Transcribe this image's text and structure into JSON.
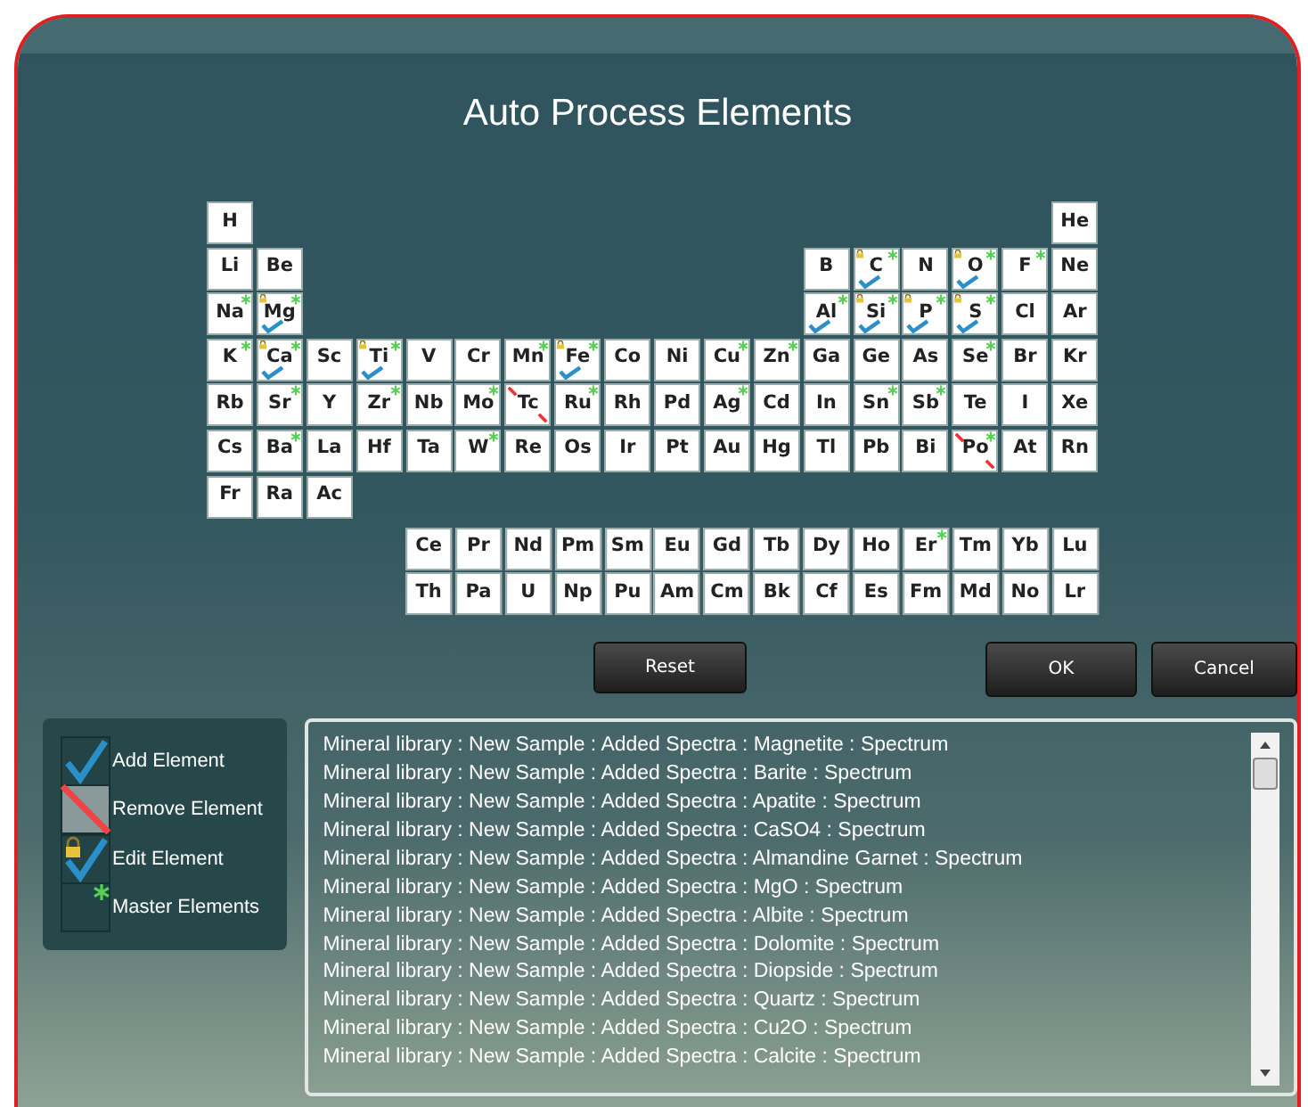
{
  "dialog": {
    "title": "Auto Process Elements"
  },
  "table": {
    "rows": [
      {
        "left": [
          {
            "symbol": "H",
            "added": false,
            "removed": false,
            "locked": false,
            "master": false
          }
        ],
        "right": [
          {
            "symbol": "He",
            "added": false,
            "removed": false,
            "locked": false,
            "master": false
          }
        ]
      },
      {
        "left": [
          {
            "symbol": "Li",
            "added": false,
            "removed": false,
            "locked": false,
            "master": false
          },
          {
            "symbol": "Be",
            "added": false,
            "removed": false,
            "locked": false,
            "master": false
          }
        ],
        "right": [
          {
            "symbol": "B",
            "added": false,
            "removed": false,
            "locked": false,
            "master": false
          },
          {
            "symbol": "C",
            "added": true,
            "removed": false,
            "locked": true,
            "master": true
          },
          {
            "symbol": "N",
            "added": false,
            "removed": false,
            "locked": false,
            "master": false
          },
          {
            "symbol": "O",
            "added": true,
            "removed": false,
            "locked": true,
            "master": true
          },
          {
            "symbol": "F",
            "added": false,
            "removed": false,
            "locked": false,
            "master": true
          },
          {
            "symbol": "Ne",
            "added": false,
            "removed": false,
            "locked": false,
            "master": false
          }
        ]
      },
      {
        "left": [
          {
            "symbol": "Na",
            "added": false,
            "removed": false,
            "locked": false,
            "master": true
          },
          {
            "symbol": "Mg",
            "added": true,
            "removed": false,
            "locked": true,
            "master": true
          }
        ],
        "right": [
          {
            "symbol": "Al",
            "added": true,
            "removed": false,
            "locked": false,
            "master": true
          },
          {
            "symbol": "Si",
            "added": true,
            "removed": false,
            "locked": true,
            "master": true
          },
          {
            "symbol": "P",
            "added": true,
            "removed": false,
            "locked": true,
            "master": true
          },
          {
            "symbol": "S",
            "added": true,
            "removed": false,
            "locked": true,
            "master": true
          },
          {
            "symbol": "Cl",
            "added": false,
            "removed": false,
            "locked": false,
            "master": false
          },
          {
            "symbol": "Ar",
            "added": false,
            "removed": false,
            "locked": false,
            "master": false
          }
        ]
      },
      {
        "left": [
          {
            "symbol": "K",
            "added": false,
            "removed": false,
            "locked": false,
            "master": true
          },
          {
            "symbol": "Ca",
            "added": true,
            "removed": false,
            "locked": true,
            "master": true
          },
          {
            "symbol": "Sc",
            "added": false,
            "removed": false,
            "locked": false,
            "master": false
          },
          {
            "symbol": "Ti",
            "added": true,
            "removed": false,
            "locked": true,
            "master": true
          },
          {
            "symbol": "V",
            "added": false,
            "removed": false,
            "locked": false,
            "master": false
          },
          {
            "symbol": "Cr",
            "added": false,
            "removed": false,
            "locked": false,
            "master": false
          },
          {
            "symbol": "Mn",
            "added": false,
            "removed": false,
            "locked": false,
            "master": true
          },
          {
            "symbol": "Fe",
            "added": true,
            "removed": false,
            "locked": true,
            "master": true
          },
          {
            "symbol": "Co",
            "added": false,
            "removed": false,
            "locked": false,
            "master": false
          },
          {
            "symbol": "Ni",
            "added": false,
            "removed": false,
            "locked": false,
            "master": false
          },
          {
            "symbol": "Cu",
            "added": false,
            "removed": false,
            "locked": false,
            "master": true
          },
          {
            "symbol": "Zn",
            "added": false,
            "removed": false,
            "locked": false,
            "master": true
          },
          {
            "symbol": "Ga",
            "added": false,
            "removed": false,
            "locked": false,
            "master": false
          },
          {
            "symbol": "Ge",
            "added": false,
            "removed": false,
            "locked": false,
            "master": false
          },
          {
            "symbol": "As",
            "added": false,
            "removed": false,
            "locked": false,
            "master": false
          },
          {
            "symbol": "Se",
            "added": false,
            "removed": false,
            "locked": false,
            "master": true
          },
          {
            "symbol": "Br",
            "added": false,
            "removed": false,
            "locked": false,
            "master": false
          },
          {
            "symbol": "Kr",
            "added": false,
            "removed": false,
            "locked": false,
            "master": false
          }
        ]
      },
      {
        "left": [
          {
            "symbol": "Rb",
            "added": false,
            "removed": false,
            "locked": false,
            "master": false
          },
          {
            "symbol": "Sr",
            "added": false,
            "removed": false,
            "locked": false,
            "master": true
          },
          {
            "symbol": "Y",
            "added": false,
            "removed": false,
            "locked": false,
            "master": false
          },
          {
            "symbol": "Zr",
            "added": false,
            "removed": false,
            "locked": false,
            "master": true
          },
          {
            "symbol": "Nb",
            "added": false,
            "removed": false,
            "locked": false,
            "master": false
          },
          {
            "symbol": "Mo",
            "added": false,
            "removed": false,
            "locked": false,
            "master": true
          },
          {
            "symbol": "Tc",
            "added": false,
            "removed": true,
            "locked": false,
            "master": false
          },
          {
            "symbol": "Ru",
            "added": false,
            "removed": false,
            "locked": false,
            "master": true
          },
          {
            "symbol": "Rh",
            "added": false,
            "removed": false,
            "locked": false,
            "master": false
          },
          {
            "symbol": "Pd",
            "added": false,
            "removed": false,
            "locked": false,
            "master": false
          },
          {
            "symbol": "Ag",
            "added": false,
            "removed": false,
            "locked": false,
            "master": true
          },
          {
            "symbol": "Cd",
            "added": false,
            "removed": false,
            "locked": false,
            "master": false
          },
          {
            "symbol": "In",
            "added": false,
            "removed": false,
            "locked": false,
            "master": false
          },
          {
            "symbol": "Sn",
            "added": false,
            "removed": false,
            "locked": false,
            "master": true
          },
          {
            "symbol": "Sb",
            "added": false,
            "removed": false,
            "locked": false,
            "master": true
          },
          {
            "symbol": "Te",
            "added": false,
            "removed": false,
            "locked": false,
            "master": false
          },
          {
            "symbol": "I",
            "added": false,
            "removed": false,
            "locked": false,
            "master": false
          },
          {
            "symbol": "Xe",
            "added": false,
            "removed": false,
            "locked": false,
            "master": false
          }
        ]
      },
      {
        "left": [
          {
            "symbol": "Cs",
            "added": false,
            "removed": false,
            "locked": false,
            "master": false
          },
          {
            "symbol": "Ba",
            "added": false,
            "removed": false,
            "locked": false,
            "master": true
          },
          {
            "symbol": "La",
            "added": false,
            "removed": false,
            "locked": false,
            "master": false
          },
          {
            "symbol": "Hf",
            "added": false,
            "removed": false,
            "locked": false,
            "master": false
          },
          {
            "symbol": "Ta",
            "added": false,
            "removed": false,
            "locked": false,
            "master": false
          },
          {
            "symbol": "W",
            "added": false,
            "removed": false,
            "locked": false,
            "master": true
          },
          {
            "symbol": "Re",
            "added": false,
            "removed": false,
            "locked": false,
            "master": false
          },
          {
            "symbol": "Os",
            "added": false,
            "removed": false,
            "locked": false,
            "master": false
          },
          {
            "symbol": "Ir",
            "added": false,
            "removed": false,
            "locked": false,
            "master": false
          },
          {
            "symbol": "Pt",
            "added": false,
            "removed": false,
            "locked": false,
            "master": false
          },
          {
            "symbol": "Au",
            "added": false,
            "removed": false,
            "locked": false,
            "master": false
          },
          {
            "symbol": "Hg",
            "added": false,
            "removed": false,
            "locked": false,
            "master": false
          },
          {
            "symbol": "Tl",
            "added": false,
            "removed": false,
            "locked": false,
            "master": false
          },
          {
            "symbol": "Pb",
            "added": false,
            "removed": false,
            "locked": false,
            "master": false
          },
          {
            "symbol": "Bi",
            "added": false,
            "removed": false,
            "locked": false,
            "master": false
          },
          {
            "symbol": "Po",
            "added": false,
            "removed": true,
            "locked": false,
            "master": true
          },
          {
            "symbol": "At",
            "added": false,
            "removed": false,
            "locked": false,
            "master": false
          },
          {
            "symbol": "Rn",
            "added": false,
            "removed": false,
            "locked": false,
            "master": false
          }
        ]
      },
      {
        "left": [
          {
            "symbol": "Fr",
            "added": false,
            "removed": false,
            "locked": false,
            "master": false
          },
          {
            "symbol": "Ra",
            "added": false,
            "removed": false,
            "locked": false,
            "master": false
          },
          {
            "symbol": "Ac",
            "added": false,
            "removed": false,
            "locked": false,
            "master": false
          }
        ]
      }
    ]
  },
  "f_block": {
    "rows": [
      {
        "left": [
          {
            "symbol": "Ce",
            "added": false,
            "removed": false,
            "locked": false,
            "master": false
          },
          {
            "symbol": "Pr",
            "added": false,
            "removed": false,
            "locked": false,
            "master": false
          },
          {
            "symbol": "Nd",
            "added": false,
            "removed": false,
            "locked": false,
            "master": false
          },
          {
            "symbol": "Pm",
            "added": false,
            "removed": false,
            "locked": false,
            "master": false
          },
          {
            "symbol": "Sm",
            "added": false,
            "removed": false,
            "locked": false,
            "master": false
          },
          {
            "symbol": "Eu",
            "added": false,
            "removed": false,
            "locked": false,
            "master": false
          },
          {
            "symbol": "Gd",
            "added": false,
            "removed": false,
            "locked": false,
            "master": false
          },
          {
            "symbol": "Tb",
            "added": false,
            "removed": false,
            "locked": false,
            "master": false
          },
          {
            "symbol": "Dy",
            "added": false,
            "removed": false,
            "locked": false,
            "master": false
          },
          {
            "symbol": "Ho",
            "added": false,
            "removed": false,
            "locked": false,
            "master": false
          },
          {
            "symbol": "Er",
            "added": false,
            "removed": false,
            "locked": false,
            "master": true
          },
          {
            "symbol": "Tm",
            "added": false,
            "removed": false,
            "locked": false,
            "master": false
          },
          {
            "symbol": "Yb",
            "added": false,
            "removed": false,
            "locked": false,
            "master": false
          },
          {
            "symbol": "Lu",
            "added": false,
            "removed": false,
            "locked": false,
            "master": false
          }
        ]
      },
      {
        "left": [
          {
            "symbol": "Th",
            "added": false,
            "removed": false,
            "locked": false,
            "master": false
          },
          {
            "symbol": "Pa",
            "added": false,
            "removed": false,
            "locked": false,
            "master": false
          },
          {
            "symbol": "U",
            "added": false,
            "removed": false,
            "locked": false,
            "master": false
          },
          {
            "symbol": "Np",
            "added": false,
            "removed": false,
            "locked": false,
            "master": false
          },
          {
            "symbol": "Pu",
            "added": false,
            "removed": false,
            "locked": false,
            "master": false
          },
          {
            "symbol": "Am",
            "added": false,
            "removed": false,
            "locked": false,
            "master": false
          },
          {
            "symbol": "Cm",
            "added": false,
            "removed": false,
            "locked": false,
            "master": false
          },
          {
            "symbol": "Bk",
            "added": false,
            "removed": false,
            "locked": false,
            "master": false
          },
          {
            "symbol": "Cf",
            "added": false,
            "removed": false,
            "locked": false,
            "master": false
          },
          {
            "symbol": "Es",
            "added": false,
            "removed": false,
            "locked": false,
            "master": false
          },
          {
            "symbol": "Fm",
            "added": false,
            "removed": false,
            "locked": false,
            "master": false
          },
          {
            "symbol": "Md",
            "added": false,
            "removed": false,
            "locked": false,
            "master": false
          },
          {
            "symbol": "No",
            "added": false,
            "removed": false,
            "locked": false,
            "master": false
          },
          {
            "symbol": "Lr",
            "added": false,
            "removed": false,
            "locked": false,
            "master": false
          }
        ]
      }
    ]
  },
  "buttons": [
    {
      "label": "Reset",
      "kind": "reset"
    },
    {
      "label": "OK",
      "kind": "ok"
    },
    {
      "label": "Cancel",
      "kind": "cancel"
    }
  ],
  "legend": [
    {
      "kind": "add",
      "label": "Add Element"
    },
    {
      "kind": "remove",
      "label": "Remove Element"
    },
    {
      "kind": "edit",
      "label": "Edit Element"
    },
    {
      "kind": "master",
      "label": "Master Elements"
    }
  ],
  "log": {
    "lines": [
      "Mineral library : New Sample : Added Spectra : Magnetite : Spectrum",
      "Mineral library : New Sample : Added Spectra : Barite : Spectrum",
      "Mineral library : New Sample : Added Spectra : Apatite : Spectrum",
      "Mineral library : New Sample : Added Spectra : CaSO4 : Spectrum",
      "Mineral library : New Sample : Added Spectra : Almandine Garnet : Spectrum",
      "Mineral library : New Sample : Added Spectra : MgO : Spectrum",
      "Mineral library : New Sample : Added Spectra : Albite : Spectrum",
      "Mineral library : New Sample : Added Spectra : Dolomite : Spectrum",
      "Mineral library : New Sample : Added Spectra : Diopside : Spectrum",
      "Mineral library : New Sample : Added Spectra : Quartz : Spectrum",
      "Mineral library : New Sample : Added Spectra : Cu2O : Spectrum",
      "Mineral library : New Sample : Added Spectra : Calcite : Spectrum"
    ]
  }
}
